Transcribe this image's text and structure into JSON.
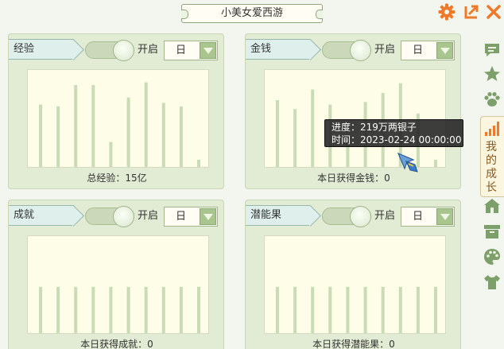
{
  "window": {
    "title": "小美女爱西游"
  },
  "colors": {
    "accent": "#f07a2a",
    "bar": "#c9dcb6",
    "panel": "#e2ebd4",
    "chart_bg": "#fefde7",
    "sidebar_icon": "#7da06a"
  },
  "panels": [
    {
      "name": "经验",
      "toggle_label": "开启",
      "dropdown_value": "日",
      "footer": "总经验：15亿",
      "chart_data": {
        "type": "bar",
        "values": [
          70,
          68,
          92,
          92,
          28,
          78,
          95,
          72,
          68,
          8
        ],
        "ylim": [
          0,
          100
        ]
      }
    },
    {
      "name": "金钱",
      "toggle_label": "开启",
      "dropdown_value": "日",
      "footer": "本日获得金钱：0",
      "chart_data": {
        "type": "bar",
        "values": [
          75,
          65,
          87,
          70,
          47,
          73,
          83,
          94,
          60,
          8
        ],
        "ylim": [
          0,
          100
        ]
      }
    },
    {
      "name": "成就",
      "toggle_label": "开启",
      "dropdown_value": "日",
      "footer": "本日获得成就：0",
      "chart_data": {
        "type": "bar",
        "values": [
          52,
          52,
          52,
          52,
          52,
          52,
          52,
          52,
          52,
          52
        ],
        "ylim": [
          0,
          100
        ]
      }
    },
    {
      "name": "潜能果",
      "toggle_label": "开启",
      "dropdown_value": "日",
      "footer": "本日获得潜能果：0",
      "chart_data": {
        "type": "bar",
        "values": [
          52,
          52,
          52,
          52,
          52,
          52,
          52,
          52,
          52,
          52
        ],
        "ylim": [
          0,
          100
        ]
      }
    }
  ],
  "tooltip": {
    "progress": "进度：219万两银子",
    "time": "时间：2023-02-24 00:00:00"
  },
  "sidebar": {
    "items": [
      {
        "icon": "message-icon"
      },
      {
        "icon": "star-icon"
      },
      {
        "icon": "paw-icon"
      },
      {
        "icon": "growth-bars-icon",
        "label": "我的成长",
        "active": true
      },
      {
        "icon": "house-icon"
      },
      {
        "icon": "box-icon"
      },
      {
        "icon": "palette-icon"
      },
      {
        "icon": "shirt-icon"
      }
    ]
  }
}
